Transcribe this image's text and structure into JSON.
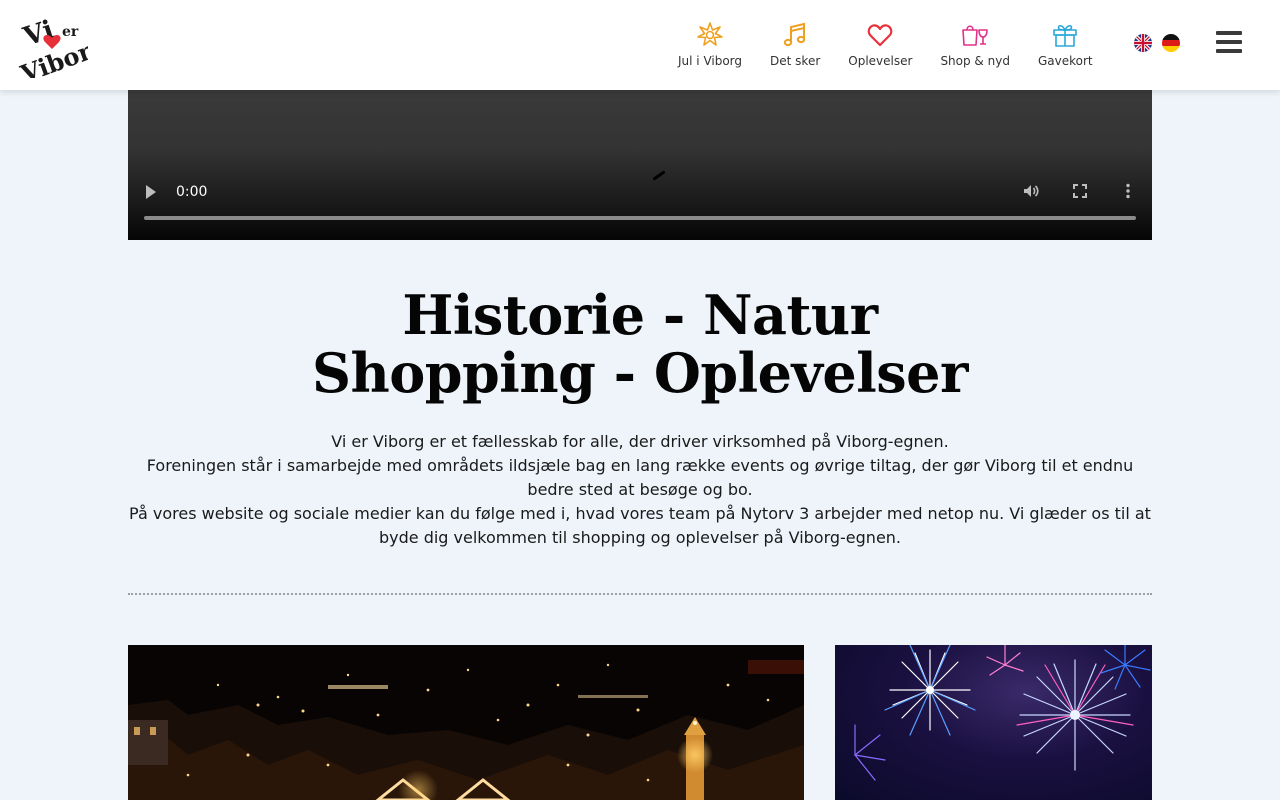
{
  "header": {
    "logo_alt": "Vi elsker Viborg",
    "nav": [
      {
        "label": "Jul i Viborg",
        "icon": "star-burst-icon",
        "color": "#f0a020"
      },
      {
        "label": "Det sker",
        "icon": "music-note-icon",
        "color": "#f0a020"
      },
      {
        "label": "Oplevelser",
        "icon": "heart-icon",
        "color": "#e8303a"
      },
      {
        "label": "Shop & nyd",
        "icon": "shopping-bag-glass-icon",
        "color": "#e0308a"
      },
      {
        "label": "Gavekort",
        "icon": "gift-icon",
        "color": "#2aa8d8"
      }
    ],
    "languages": [
      "en-flag-icon",
      "de-flag-icon"
    ],
    "menu_icon": "hamburger-menu-icon"
  },
  "video": {
    "current_time": "0:00",
    "controls": [
      "play-icon",
      "volume-icon",
      "fullscreen-icon",
      "more-options-icon"
    ]
  },
  "intro": {
    "headline_line1": "Historie - Natur",
    "headline_line2": "Shopping - Oplevelser",
    "paragraph1": "Vi er Viborg er et fællesskab for alle, der driver virksomhed på Viborg-egnen.",
    "paragraph2": "Foreningen står i samarbejde med områdets ildsjæle bag en lang række events og øvrige tiltag, der gør Viborg til et endnu bedre sted at besøge og bo.",
    "paragraph3": "På vores website og sociale medier kan du følge med i, hvad vores team på Nytorv 3 arbejder med netop nu. Vi glæder os til at byde dig velkommen til shopping og oplevelser på Viborg-egnen."
  },
  "colors": {
    "page_bg": "#eef4fa",
    "header_bg": "#ffffff",
    "accent_heart": "#e8303a"
  }
}
